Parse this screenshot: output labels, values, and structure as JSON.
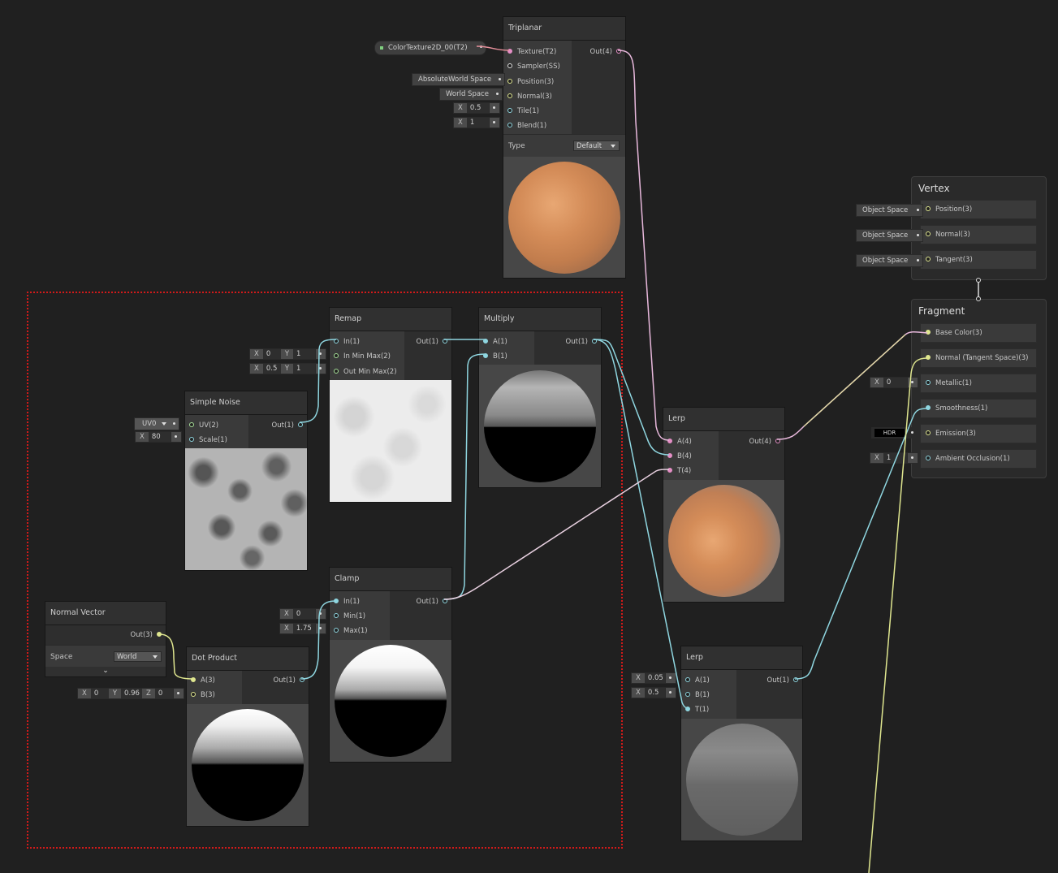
{
  "triplanar": {
    "title": "Triplanar",
    "inputs": [
      "Texture(T2)",
      "Sampler(SS)",
      "Position(3)",
      "Normal(3)",
      "Tile(1)",
      "Blend(1)"
    ],
    "output": "Out(4)",
    "texture_property": "ColorTexture2D_00(T2)",
    "position_space": "AbsoluteWorld Space",
    "normal_space": "World Space",
    "tile_label": "X",
    "tile_value": "0.5",
    "blend_label": "X",
    "blend_value": "1",
    "type_label": "Type",
    "type_value": "Default"
  },
  "remap": {
    "title": "Remap",
    "inputs": [
      "In(1)",
      "In Min Max(2)",
      "Out Min Max(2)"
    ],
    "output": "Out(1)",
    "in_min_max": {
      "x_label": "X",
      "x": "0",
      "y_label": "Y",
      "y": "1"
    },
    "out_min_max": {
      "x_label": "X",
      "x": "0.5",
      "y_label": "Y",
      "y": "1"
    }
  },
  "multiply": {
    "title": "Multiply",
    "inputs": [
      "A(1)",
      "B(1)"
    ],
    "output": "Out(1)"
  },
  "simple_noise": {
    "title": "Simple Noise",
    "inputs": [
      "UV(2)",
      "Scale(1)"
    ],
    "output": "Out(1)",
    "uv_value": "UV0",
    "scale_label": "X",
    "scale_value": "80"
  },
  "clamp": {
    "title": "Clamp",
    "inputs": [
      "In(1)",
      "Min(1)",
      "Max(1)"
    ],
    "output": "Out(1)",
    "min_label": "X",
    "min_value": "0",
    "max_label": "X",
    "max_value": "1.75"
  },
  "normal_vector": {
    "title": "Normal Vector",
    "output": "Out(3)",
    "space_label": "Space",
    "space_value": "World"
  },
  "dot_product": {
    "title": "Dot Product",
    "inputs": [
      "A(3)",
      "B(3)"
    ],
    "output": "Out(1)",
    "b_x_label": "X",
    "b_x": "0",
    "b_y_label": "Y",
    "b_y": "0.96",
    "b_z_label": "Z",
    "b_z": "0"
  },
  "lerp_color": {
    "title": "Lerp",
    "inputs": [
      "A(4)",
      "B(4)",
      "T(4)"
    ],
    "output": "Out(4)"
  },
  "lerp_smooth": {
    "title": "Lerp",
    "inputs": [
      "A(1)",
      "B(1)",
      "T(1)"
    ],
    "output": "Out(1)",
    "a_label": "X",
    "a_value": "0.05",
    "b_label": "X",
    "b_value": "0.5"
  },
  "vertex": {
    "title": "Vertex",
    "slots": [
      "Position(3)",
      "Normal(3)",
      "Tangent(3)"
    ],
    "spaces": [
      "Object Space",
      "Object Space",
      "Object Space"
    ]
  },
  "fragment": {
    "title": "Fragment",
    "slots": [
      "Base Color(3)",
      "Normal (Tangent Space)(3)",
      "Metallic(1)",
      "Smoothness(1)",
      "Emission(3)",
      "Ambient Occlusion(1)"
    ],
    "metallic_label": "X",
    "metallic_value": "0",
    "emission_mode": "HDR",
    "ao_label": "X",
    "ao_value": "1"
  },
  "colors": {
    "wire_vector1": "#8fd6e0",
    "wire_vector4": "#e8b8dc",
    "wire_vector3": "#dfe68f",
    "selection": "#d21a1a"
  }
}
